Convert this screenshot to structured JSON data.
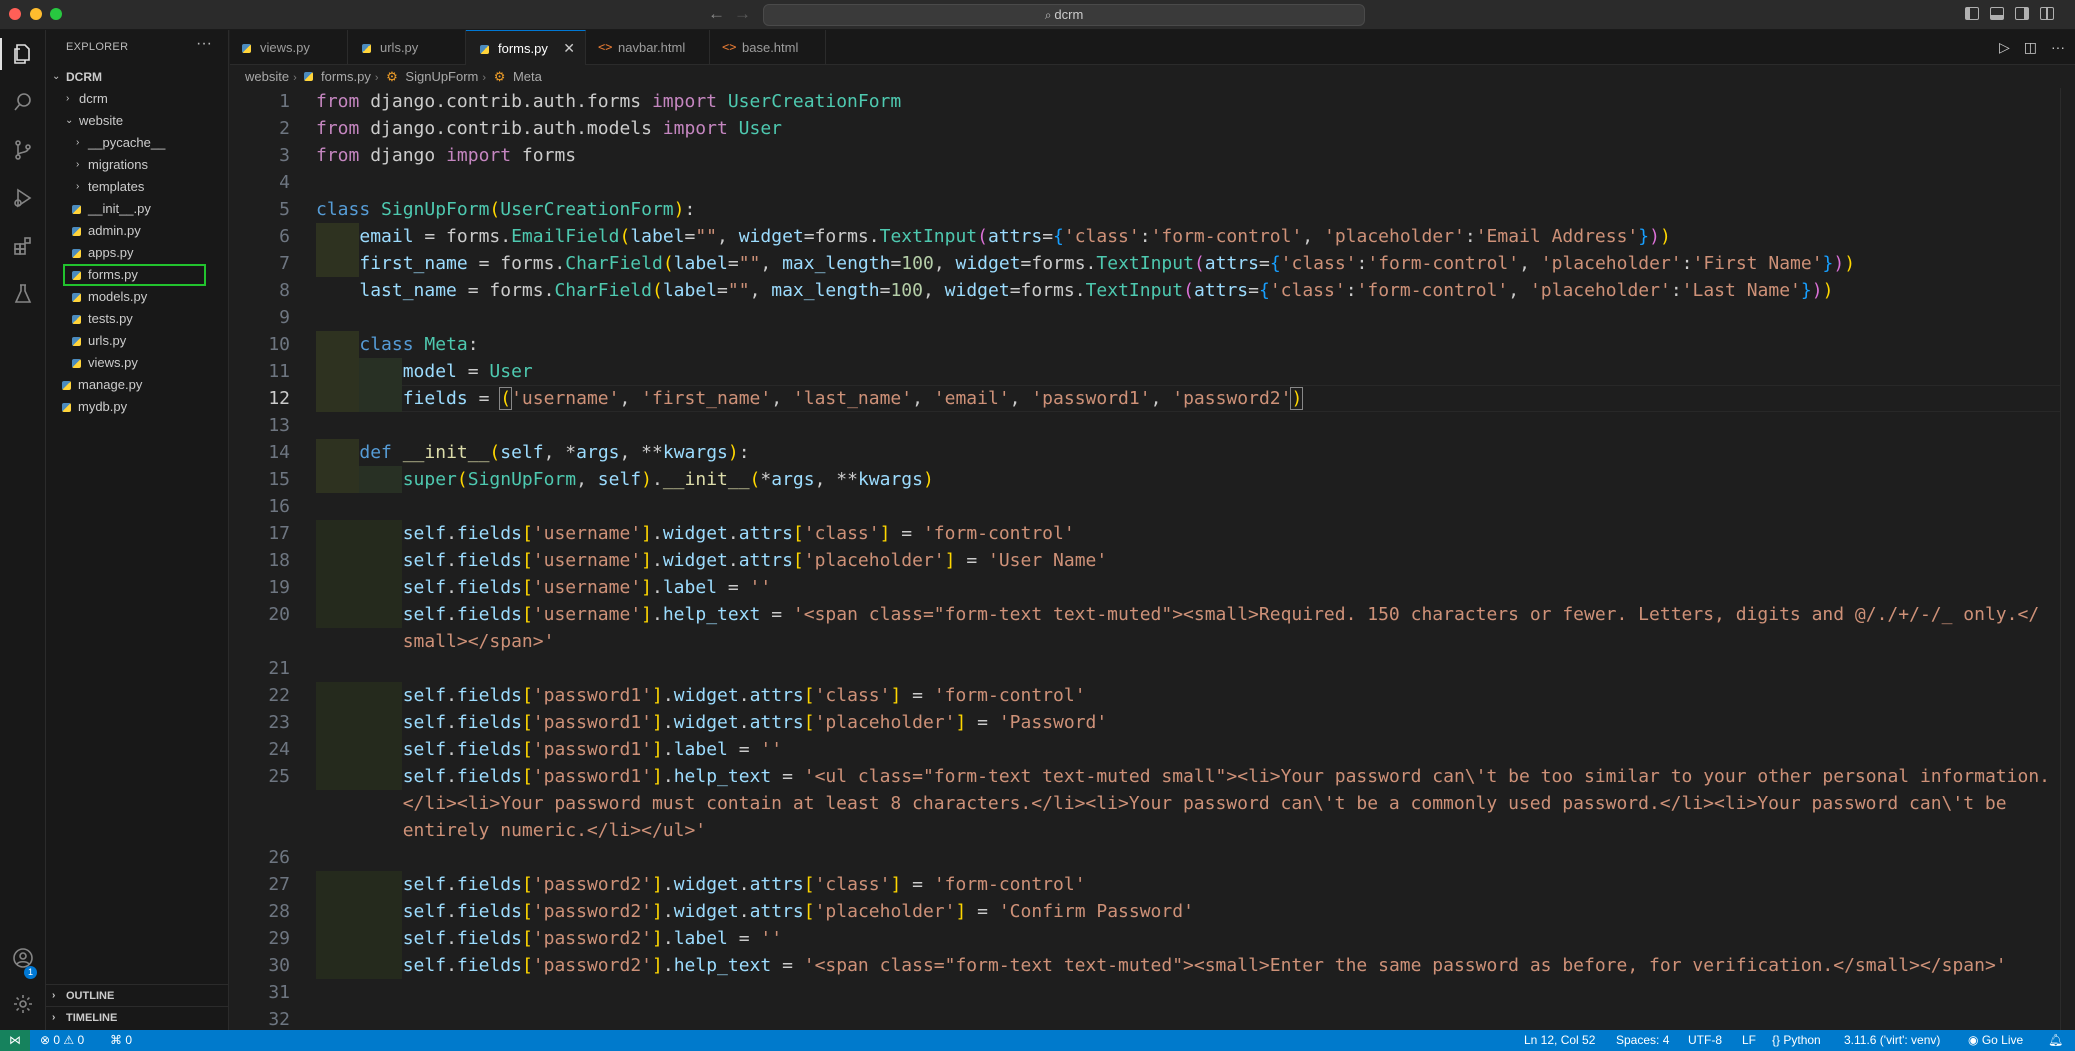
{
  "window": {
    "search_text": "dcrm"
  },
  "sidebar": {
    "title": "EXPLORER",
    "root": "DCRM",
    "items": [
      {
        "label": "dcrm",
        "type": "folder",
        "expanded": false
      },
      {
        "label": "website",
        "type": "folder",
        "expanded": true
      },
      {
        "label": "__pycache__",
        "type": "folder",
        "expanded": false
      },
      {
        "label": "migrations",
        "type": "folder",
        "expanded": false
      },
      {
        "label": "templates",
        "type": "folder",
        "expanded": false
      },
      {
        "label": "__init__.py",
        "type": "file"
      },
      {
        "label": "admin.py",
        "type": "file"
      },
      {
        "label": "apps.py",
        "type": "file"
      },
      {
        "label": "forms.py",
        "type": "file",
        "selected": true
      },
      {
        "label": "models.py",
        "type": "file"
      },
      {
        "label": "tests.py",
        "type": "file"
      },
      {
        "label": "urls.py",
        "type": "file"
      },
      {
        "label": "views.py",
        "type": "file"
      },
      {
        "label": "manage.py",
        "type": "file"
      },
      {
        "label": "mydb.py",
        "type": "file"
      }
    ],
    "outline_label": "OUTLINE",
    "timeline_label": "TIMELINE",
    "account_badge": "1"
  },
  "tabs": [
    {
      "label": "views.py",
      "active": false
    },
    {
      "label": "urls.py",
      "active": false
    },
    {
      "label": "forms.py",
      "active": true
    },
    {
      "label": "navbar.html",
      "active": false
    },
    {
      "label": "base.html",
      "active": false
    }
  ],
  "breadcrumb": {
    "folder": "website",
    "file": "forms.py",
    "class": "SignUpForm",
    "member": "Meta"
  },
  "editor": {
    "line_numbers": [
      "1",
      "2",
      "3",
      "4",
      "5",
      "6",
      "7",
      "8",
      "9",
      "10",
      "11",
      "12",
      "13",
      "14",
      "15",
      "16",
      "17",
      "18",
      "19",
      "20",
      "",
      "21",
      "22",
      "23",
      "24",
      "25",
      "",
      "",
      "26",
      "27",
      "28",
      "29",
      "30",
      "31",
      "32"
    ],
    "current_line": "12"
  },
  "statusbar": {
    "problems": "⊗ 0 ⚠ 0",
    "ports": "⌘ 0",
    "position": "Ln 12, Col 52",
    "spaces": "Spaces: 4",
    "encoding": "UTF-8",
    "eol": "LF",
    "language": "Python",
    "interpreter": "3.11.6 ('virt': venv)",
    "golive": "Go Live"
  },
  "colors": {
    "accent": "#007acc",
    "selection_outline": "#22c32e"
  }
}
